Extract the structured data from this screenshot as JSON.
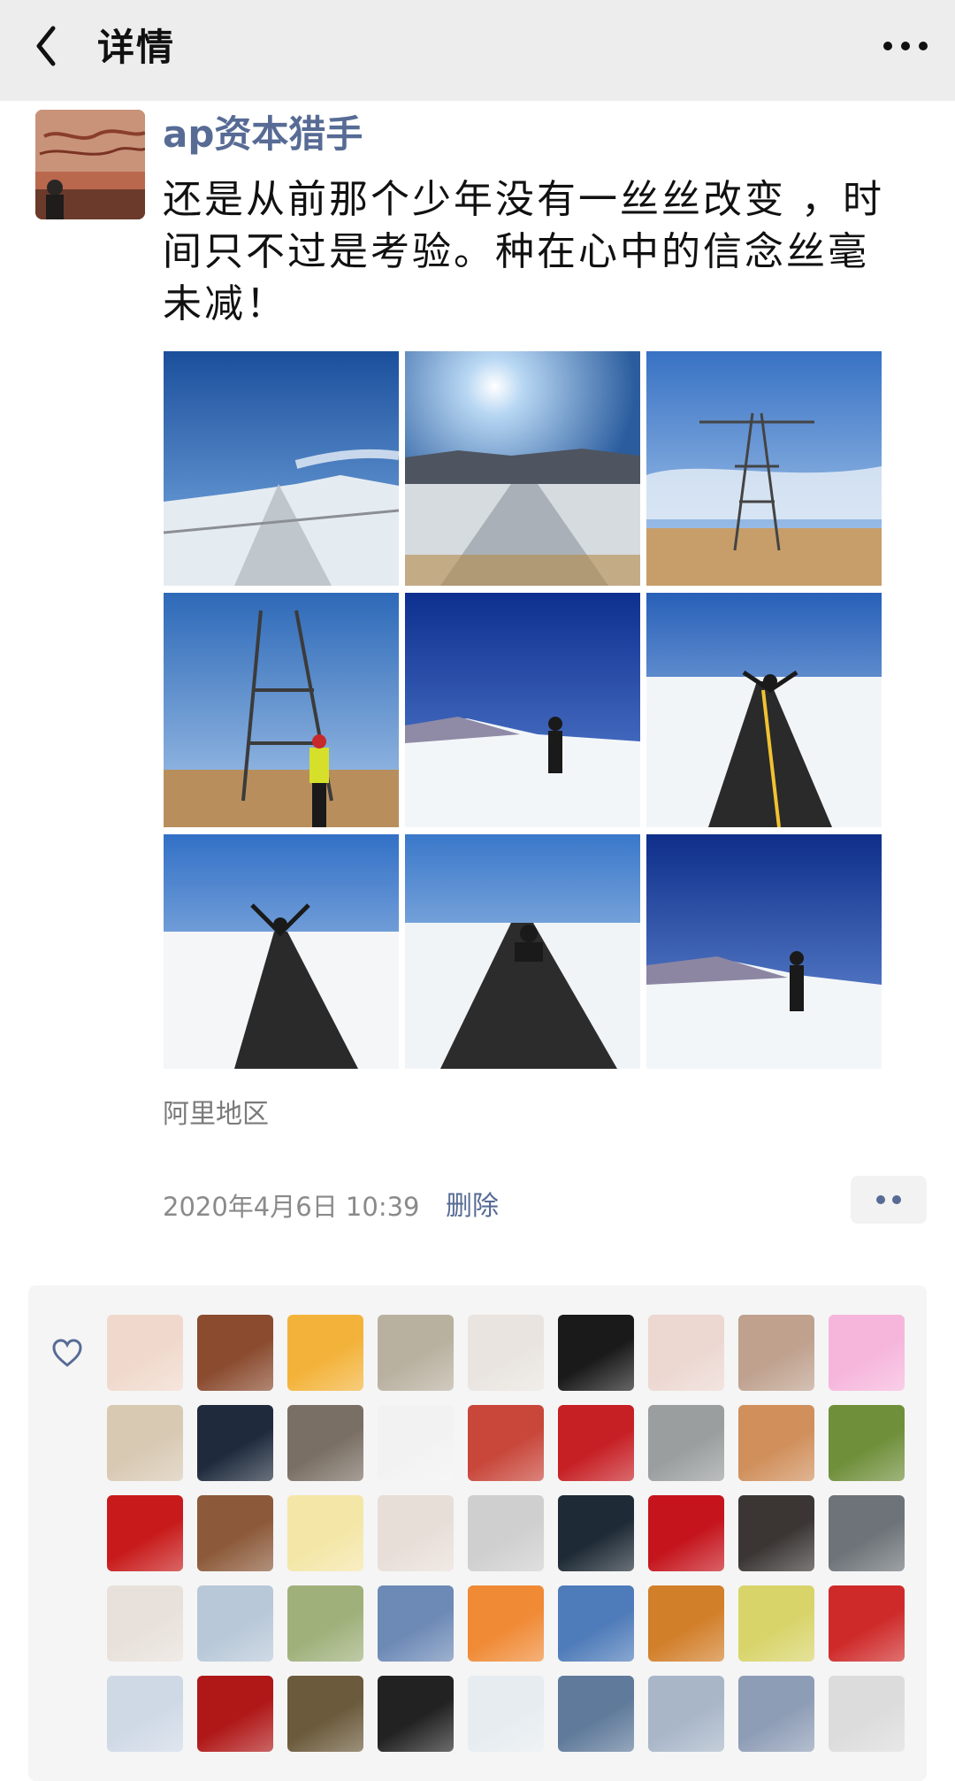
{
  "header": {
    "title": "详情",
    "back_icon": "chevron-left-icon",
    "more_icon": "more-dots-icon"
  },
  "post": {
    "username": "ap资本猎手",
    "text": "还是从前那个少年没有一丝丝改变 ，时间只不过是考验。种在心中的信念丝毫未减！",
    "location": "阿里地区",
    "time": "2020年4月6日  10:39",
    "delete_label": "删除",
    "action_icon": "two-dots-icon",
    "photos": [
      {
        "scene": "snow-road-sky"
      },
      {
        "scene": "road-sun"
      },
      {
        "scene": "pylon-sky"
      },
      {
        "scene": "pylon-person"
      },
      {
        "scene": "person-snowfield"
      },
      {
        "scene": "person-road-arms"
      },
      {
        "scene": "person-road-arms"
      },
      {
        "scene": "person-sitting-road"
      },
      {
        "scene": "person-snowfield"
      }
    ]
  },
  "likes": {
    "icon": "heart-outline-icon",
    "colors": [
      [
        "#f0d9cc",
        "#8a4b2f",
        "#f3b33a",
        "#b9b1a0",
        "#e9e4df",
        "#1a1a1a",
        "#ecd7d1",
        "#bfa18e",
        "#f6b6dc"
      ],
      [
        "#d8c9b3",
        "#1f2b3d",
        "#7a6f64",
        "#f2f2f2",
        "#c8463a",
        "#c61f24",
        "#9a9e9f",
        "#d08f5b",
        "#6f8f3a"
      ],
      [
        "#c81a1a",
        "#8c5a3a",
        "#f4e6a6",
        "#e8ded8",
        "#cfcfcf",
        "#1e2a35",
        "#c5141c",
        "#3b3634",
        "#6d7378"
      ],
      [
        "#e8e1db",
        "#b8c8d8",
        "#9fb07a",
        "#6d8ab6",
        "#f08a35",
        "#4e7bb9",
        "#d27f2a",
        "#d8d46a",
        "#cf2a2a"
      ],
      [
        "#cfd9e6",
        "#b01818",
        "#6b5a3b",
        "#222222",
        "#e6ecf0",
        "#5f7a9a",
        "#a8b6c8",
        "#8e9db6",
        "#dcdcdc"
      ]
    ]
  }
}
